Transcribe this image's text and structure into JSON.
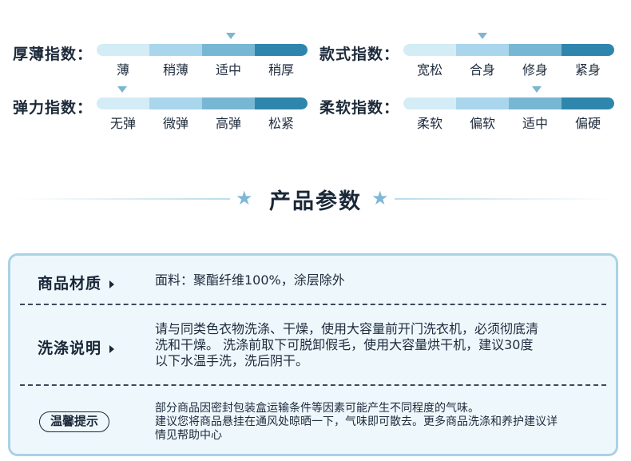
{
  "indices": [
    {
      "label": "厚薄指数：",
      "ticks": [
        "薄",
        "稍薄",
        "适中",
        "稍厚"
      ],
      "selected_index": 2
    },
    {
      "label": "款式指数：",
      "ticks": [
        "宽松",
        "合身",
        "修身",
        "紧身"
      ],
      "selected_index": 1
    },
    {
      "label": "弹力指数：",
      "ticks": [
        "无弹",
        "微弹",
        "高弹",
        "松紧"
      ],
      "selected_index": 0
    },
    {
      "label": "柔软指数：",
      "ticks": [
        "柔软",
        "偏软",
        "适中",
        "偏硬"
      ],
      "selected_index": 2
    }
  ],
  "section_title": "产品参数",
  "title_star": "★",
  "params": {
    "material_label": "商品材质",
    "material_value": "面料：聚酯纤维100%，涂层除外",
    "wash_label": "洗涤说明",
    "wash_line1": "请与同类色衣物洗涤、干燥，使用大容量前开门洗衣机，必须彻底清",
    "wash_line2": "洗和干燥。 洗涤前取下可脱卸假毛，使用大容量烘干机，建议30度",
    "wash_line3": "以下水温手洗，洗后阴干。",
    "tip_badge": "温馨提示",
    "tip_line1": "部分商品因密封包装盒运输条件等因素可能产生不同程度的气味。",
    "tip_line2": "建议您将商品悬挂在通风处晾晒一下，气味即可散去。更多商品洗涤和养护建议详",
    "tip_line3": "情见帮助中心"
  },
  "colors": {
    "bar_segment_1": "#d4ecf6",
    "bar_segment_2": "#a9d6ec",
    "bar_segment_3": "#78b7d3",
    "bar_segment_4": "#2f86ad",
    "marker": "#7cb6d1",
    "card_border": "#a9d2e6",
    "card_background": "#eef7fc"
  }
}
